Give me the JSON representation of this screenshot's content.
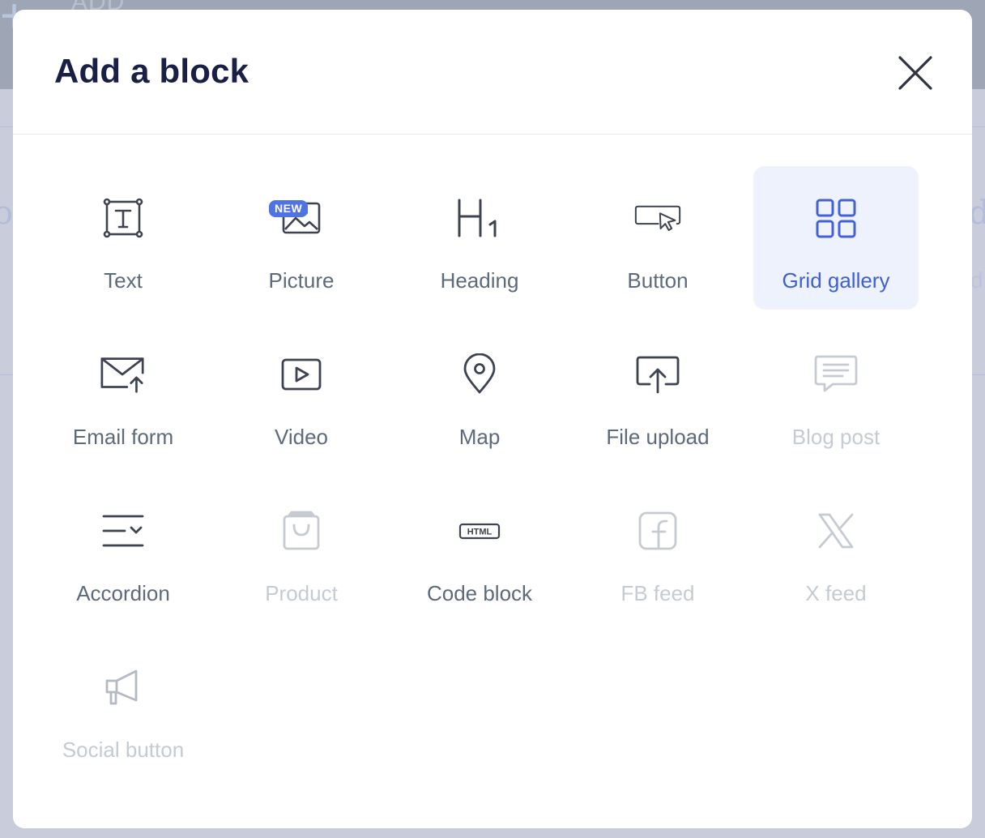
{
  "background": {
    "add_text": "ADD"
  },
  "modal": {
    "title": "Add a block",
    "close_icon": "close-icon"
  },
  "blocks": [
    {
      "label": "Text",
      "icon": "text-icon",
      "state": "enabled"
    },
    {
      "label": "Picture",
      "icon": "picture-icon",
      "state": "enabled",
      "badge": "NEW"
    },
    {
      "label": "Heading",
      "icon": "heading-icon",
      "state": "enabled"
    },
    {
      "label": "Button",
      "icon": "button-icon",
      "state": "enabled"
    },
    {
      "label": "Grid gallery",
      "icon": "grid-gallery-icon",
      "state": "selected"
    },
    {
      "label": "Email form",
      "icon": "email-form-icon",
      "state": "enabled"
    },
    {
      "label": "Video",
      "icon": "video-icon",
      "state": "enabled"
    },
    {
      "label": "Map",
      "icon": "map-pin-icon",
      "state": "enabled"
    },
    {
      "label": "File upload",
      "icon": "file-upload-icon",
      "state": "enabled"
    },
    {
      "label": "Blog post",
      "icon": "blog-post-icon",
      "state": "disabled"
    },
    {
      "label": "Accordion",
      "icon": "accordion-icon",
      "state": "enabled"
    },
    {
      "label": "Product",
      "icon": "shopping-bag-icon",
      "state": "disabled"
    },
    {
      "label": "Code block",
      "icon": "html-code-icon",
      "state": "enabled",
      "icon_text": "HTML"
    },
    {
      "label": "FB feed",
      "icon": "facebook-icon",
      "state": "disabled"
    },
    {
      "label": "X feed",
      "icon": "x-logo-icon",
      "state": "disabled"
    },
    {
      "label": "Social button",
      "icon": "megaphone-icon",
      "state": "disabled"
    }
  ],
  "colors": {
    "title": "#1a1f45",
    "accent": "#3f5fd3",
    "selected_bg": "#eef2fd",
    "badge": "#5073e2",
    "label": "#5d6a7b",
    "disabled": "#c5cbd3"
  }
}
